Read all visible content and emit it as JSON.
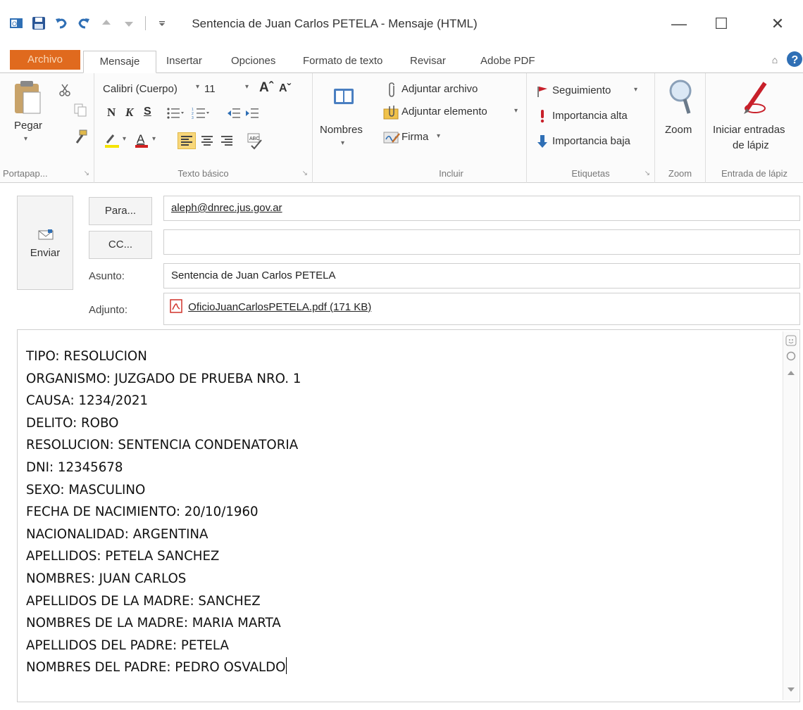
{
  "window": {
    "title": "Sentencia de Juan Carlos PETELA - Mensaje (HTML)",
    "controls": {
      "minimize": "—",
      "maximize": "☐",
      "close": "✕"
    }
  },
  "quick_access": [
    "outlook-icon",
    "save-icon",
    "undo-icon",
    "redo-icon",
    "up-arrow-icon",
    "down-arrow-icon",
    "customize-icon"
  ],
  "tabs": [
    {
      "label": "Archivo"
    },
    {
      "label": "Mensaje"
    },
    {
      "label": "Insertar"
    },
    {
      "label": "Opciones"
    },
    {
      "label": "Formato de texto"
    },
    {
      "label": "Revisar"
    },
    {
      "label": "Adobe PDF"
    }
  ],
  "ribbon": {
    "clipboard": {
      "paste": "Pegar",
      "label": "Portapap..."
    },
    "basic_text": {
      "font_name": "Calibri (Cuerpo)",
      "font_size": "11",
      "bold": "N",
      "italic": "K",
      "underline": "S",
      "label": "Texto básico"
    },
    "names": {
      "label_btn": "Nombres"
    },
    "include": {
      "attach_file": "Adjuntar archivo",
      "attach_item": "Adjuntar elemento",
      "signature": "Firma",
      "label": "Incluir"
    },
    "tags": {
      "follow_up": "Seguimiento",
      "high": "Importancia alta",
      "low": "Importancia baja",
      "label": "Etiquetas"
    },
    "zoom": {
      "btn": "Zoom",
      "label": "Zoom"
    },
    "ink": {
      "btn_line1": "Iniciar entradas",
      "btn_line2": "de lápiz",
      "label": "Entrada de lápiz"
    }
  },
  "compose": {
    "send": "Enviar",
    "to_button": "Para...",
    "to_value": "aleph@dnrec.jus.gov.ar",
    "cc_button": "CC...",
    "cc_value": "",
    "subject_label": "Asunto:",
    "subject_value": "Sentencia de Juan Carlos PETELA",
    "attachment_label": "Adjunto:",
    "attachment_value": "OficioJuanCarlosPETELA.pdf (171 KB)"
  },
  "body": {
    "lines": [
      "TIPO: RESOLUCION",
      "ORGANISMO: JUZGADO DE PRUEBA NRO. 1",
      "CAUSA: 1234/2021",
      "DELITO: ROBO",
      "RESOLUCION: SENTENCIA CONDENATORIA",
      "DNI: 12345678",
      "SEXO: MASCULINO",
      "FECHA DE NACIMIENTO: 20/10/1960",
      "NACIONALIDAD: ARGENTINA",
      "APELLIDOS: PETELA SANCHEZ",
      "NOMBRES: JUAN CARLOS",
      "APELLIDOS DE LA MADRE: SANCHEZ",
      "NOMBRES DE LA MADRE: MARIA MARTA",
      "APELLIDOS DEL PADRE: PETELA",
      "NOMBRES DEL PADRE: PEDRO OSVALDO"
    ]
  },
  "colors": {
    "file_tab": "#e06a1e",
    "save_icon": "#2b5797",
    "undo_icon": "#2f6fb5",
    "flag_red": "#c8202a",
    "pdf_red": "#d1322a",
    "low_importance": "#2f6fb5"
  }
}
